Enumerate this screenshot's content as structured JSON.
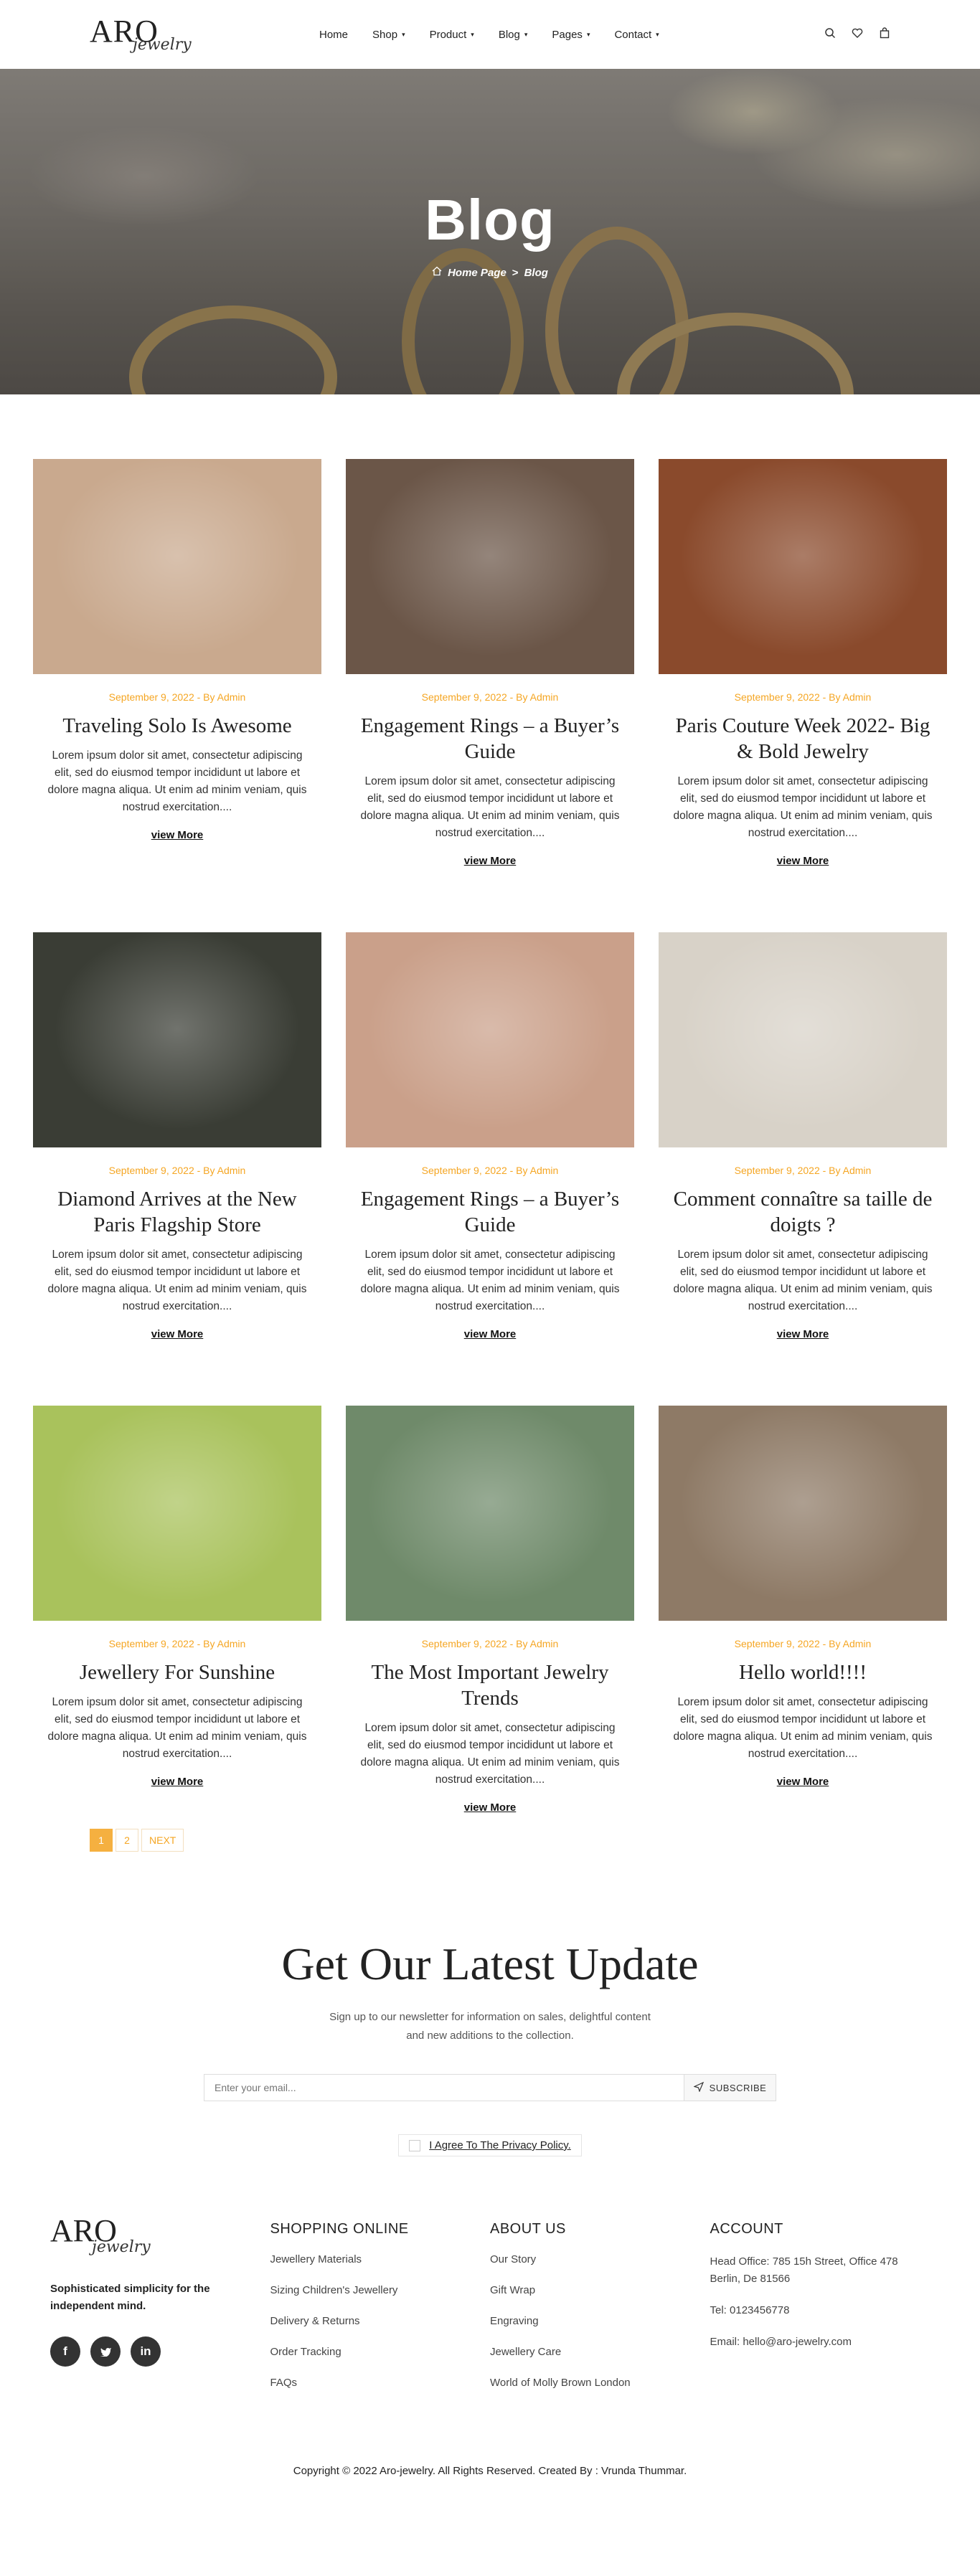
{
  "header": {
    "logo_main": "ARO",
    "logo_script": "jewelry",
    "nav": [
      {
        "label": "Home",
        "caret": ""
      },
      {
        "label": "Shop",
        "caret": "▾"
      },
      {
        "label": "Product",
        "caret": "▾"
      },
      {
        "label": "Blog",
        "caret": "▾"
      },
      {
        "label": "Pages",
        "caret": "▾"
      },
      {
        "label": "Contact",
        "caret": "▾"
      }
    ],
    "icons": [
      "search-icon",
      "heart-icon",
      "bag-icon"
    ]
  },
  "hero": {
    "title": "Blog",
    "breadcrumb_home": "Home Page",
    "breadcrumb_sep": ">",
    "breadcrumb_current": "Blog"
  },
  "posts": [
    {
      "meta": "September 9, 2022 - By Admin",
      "title": "Traveling Solo Is Awesome",
      "excerpt": "Lorem ipsum dolor sit amet, consectetur adipiscing elit, sed do eiusmod tempor incididunt ut labore et dolore magna aliqua. Ut enim ad minim veniam, quis nostrud exercitation....",
      "more": "view More"
    },
    {
      "meta": "September 9, 2022 - By Admin",
      "title": "Engagement Rings – a Buyer’s Guide",
      "excerpt": "Lorem ipsum dolor sit amet, consectetur adipiscing elit, sed do eiusmod tempor incididunt ut labore et dolore magna aliqua. Ut enim ad minim veniam, quis nostrud exercitation....",
      "more": "view More"
    },
    {
      "meta": "September 9, 2022 - By Admin",
      "title": "Paris Couture Week 2022- Big & Bold Jewelry",
      "excerpt": "Lorem ipsum dolor sit amet, consectetur adipiscing elit, sed do eiusmod tempor incididunt ut labore et dolore magna aliqua. Ut enim ad minim veniam, quis nostrud exercitation....",
      "more": "view More"
    },
    {
      "meta": "September 9, 2022 - By Admin",
      "title": "Diamond Arrives at the New Paris Flagship Store",
      "excerpt": "Lorem ipsum dolor sit amet, consectetur adipiscing elit, sed do eiusmod tempor incididunt ut labore et dolore magna aliqua. Ut enim ad minim veniam, quis nostrud exercitation....",
      "more": "view More"
    },
    {
      "meta": "September 9, 2022 - By Admin",
      "title": "Engagement Rings – a Buyer’s Guide",
      "excerpt": "Lorem ipsum dolor sit amet, consectetur adipiscing elit, sed do eiusmod tempor incididunt ut labore et dolore magna aliqua. Ut enim ad minim veniam, quis nostrud exercitation....",
      "more": "view More"
    },
    {
      "meta": "September 9, 2022 - By Admin",
      "title": "Comment connaître sa taille de doigts ?",
      "excerpt": "Lorem ipsum dolor sit amet, consectetur adipiscing elit, sed do eiusmod tempor incididunt ut labore et dolore magna aliqua. Ut enim ad minim veniam, quis nostrud exercitation....",
      "more": "view More"
    },
    {
      "meta": "September 9, 2022 - By Admin",
      "title": "Jewellery For Sunshine",
      "excerpt": "Lorem ipsum dolor sit amet, consectetur adipiscing elit, sed do eiusmod tempor incididunt ut labore et dolore magna aliqua. Ut enim ad minim veniam, quis nostrud exercitation....",
      "more": "view More"
    },
    {
      "meta": "September 9, 2022 - By Admin",
      "title": "The Most Important Jewelry Trends",
      "excerpt": "Lorem ipsum dolor sit amet, consectetur adipiscing elit, sed do eiusmod tempor incididunt ut labore et dolore magna aliqua. Ut enim ad minim veniam, quis nostrud exercitation....",
      "more": "view More"
    },
    {
      "meta": "September 9, 2022 - By Admin",
      "title": "Hello world!!!!",
      "excerpt": "Lorem ipsum dolor sit amet, consectetur adipiscing elit, sed do eiusmod tempor incididunt ut labore et dolore magna aliqua. Ut enim ad minim veniam, quis nostrud exercitation....",
      "more": "view More"
    }
  ],
  "thumb_colors": [
    "#c9a98e",
    "#6b5648",
    "#8a4a2c",
    "#3a3d35",
    "#caa08a",
    "#d8d2c8",
    "#a9c25c",
    "#6f8a6a",
    "#8e7a66"
  ],
  "pagination": {
    "pages": [
      "1",
      "2"
    ],
    "next": "NEXT",
    "active": "1"
  },
  "newsletter": {
    "title": "Get Our Latest Update",
    "line1": "Sign up to our newsletter for information on sales, delightful content",
    "line2": "and new additions to the collection.",
    "placeholder": "Enter your email...",
    "button": "SUBSCRIBE",
    "agree": "I Agree To The Privacy Policy."
  },
  "footer": {
    "logo_main": "ARO",
    "logo_script": "jewelry",
    "tagline": "Sophisticated simplicity for the independent mind.",
    "socials": [
      "facebook-icon",
      "twitter-icon",
      "linkedin-icon"
    ],
    "shopping": {
      "title": "SHOPPING ONLINE",
      "items": [
        "Jewellery Materials",
        "Sizing Children's Jewellery",
        "Delivery & Returns",
        "Order Tracking",
        "FAQs"
      ]
    },
    "about": {
      "title": "ABOUT US",
      "items": [
        "Our Story",
        "Gift Wrap",
        "Engraving",
        "Jewellery Care",
        "World of Molly Brown London"
      ]
    },
    "account": {
      "title": "ACCOUNT",
      "address": "Head Office: 785 15h Street, Office 478 Berlin, De 81566",
      "tel": "Tel: 0123456778",
      "email": "Email: hello@aro-jewelry.com"
    },
    "copyright": "Copyright © 2022 Aro-jewelry. All Rights Reserved. Created By : Vrunda Thummar."
  }
}
